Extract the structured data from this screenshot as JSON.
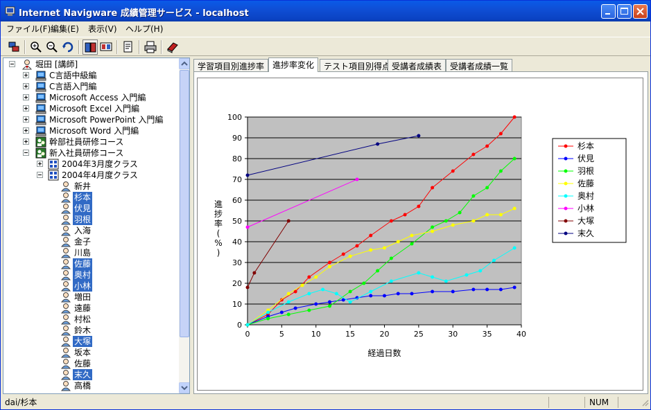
{
  "window": {
    "title": "Internet Navigware 成績管理サービス - localhost"
  },
  "menu": [
    {
      "label": "ファイル(F)"
    },
    {
      "label": "編集(E)"
    },
    {
      "label": "表示(V)"
    },
    {
      "label": "ヘルプ(H)"
    }
  ],
  "tree": {
    "root": "堀田 [講師]",
    "courses": [
      {
        "label": "C言語中級編"
      },
      {
        "label": "C言語入門編"
      },
      {
        "label": "Microsoft Access 入門編"
      },
      {
        "label": "Microsoft Excel 入門編"
      },
      {
        "label": "Microsoft PowerPoint 入門編"
      },
      {
        "label": "Microsoft Word 入門編"
      },
      {
        "label": "幹部社員研修コース"
      },
      {
        "label": "新入社員研修コース"
      }
    ],
    "classes": [
      {
        "label": "2004年3月度クラス"
      },
      {
        "label": "2004年4月度クラス"
      }
    ],
    "students": [
      {
        "label": "新井",
        "selected": false
      },
      {
        "label": "杉本",
        "selected": true
      },
      {
        "label": "伏見",
        "selected": true
      },
      {
        "label": "羽根",
        "selected": true
      },
      {
        "label": "入海",
        "selected": false
      },
      {
        "label": "金子",
        "selected": false
      },
      {
        "label": "川島",
        "selected": false
      },
      {
        "label": "佐藤",
        "selected": true
      },
      {
        "label": "奥村",
        "selected": true
      },
      {
        "label": "小林",
        "selected": true
      },
      {
        "label": "増田",
        "selected": false
      },
      {
        "label": "遠藤",
        "selected": false
      },
      {
        "label": "村松",
        "selected": false
      },
      {
        "label": "鈴木",
        "selected": false
      },
      {
        "label": "大塚",
        "selected": true
      },
      {
        "label": "坂本",
        "selected": false
      },
      {
        "label": "佐藤",
        "selected": false
      },
      {
        "label": "末久",
        "selected": true
      },
      {
        "label": "高橋",
        "selected": false
      }
    ]
  },
  "tabs": [
    {
      "label": "学習項目別進捗率",
      "active": false
    },
    {
      "label": "進捗率変化",
      "active": true
    },
    {
      "label": "テスト項目別得点",
      "active": false
    },
    {
      "label": "受講者成績表",
      "active": false
    },
    {
      "label": "受講者成績一覧",
      "active": false
    }
  ],
  "status": {
    "path": "dai/杉本",
    "num": "NUM"
  },
  "chart_data": {
    "type": "line",
    "title": "",
    "xlabel": "経過日数",
    "ylabel": "進捗率(%)",
    "xlim": [
      0,
      40
    ],
    "ylim": [
      0,
      100
    ],
    "xticks": [
      0,
      5,
      10,
      15,
      20,
      25,
      30,
      35,
      40
    ],
    "yticks": [
      0,
      10,
      20,
      30,
      40,
      50,
      60,
      70,
      80,
      90,
      100
    ],
    "grid": true,
    "legend": "right",
    "plot_bg": "#c0c0c0",
    "series": [
      {
        "name": "杉本",
        "color": "#ff0000",
        "x": [
          0,
          3,
          5,
          7,
          9,
          12,
          14,
          16,
          18,
          21,
          23,
          25,
          27,
          30,
          33,
          35,
          37,
          39
        ],
        "y": [
          0,
          5,
          12,
          16,
          23,
          30,
          34,
          38,
          43,
          50,
          53,
          57,
          66,
          74,
          82,
          86,
          92,
          100
        ]
      },
      {
        "name": "伏見",
        "color": "#0000ff",
        "x": [
          0,
          3,
          5,
          7,
          10,
          12,
          14,
          16,
          18,
          20,
          22,
          24,
          27,
          30,
          33,
          35,
          37,
          39
        ],
        "y": [
          0,
          4,
          6,
          8,
          10,
          11,
          12,
          13,
          14,
          14,
          15,
          15,
          16,
          16,
          17,
          17,
          17,
          18
        ]
      },
      {
        "name": "羽根",
        "color": "#00ff00",
        "x": [
          0,
          3,
          6,
          9,
          12,
          15,
          17,
          19,
          21,
          24,
          27,
          29,
          31,
          33,
          35,
          37,
          39
        ],
        "y": [
          0,
          3,
          5,
          7,
          9,
          16,
          20,
          26,
          32,
          39,
          47,
          50,
          54,
          62,
          66,
          74,
          80
        ]
      },
      {
        "name": "佐藤",
        "color": "#ffff00",
        "x": [
          0,
          3,
          6,
          8,
          10,
          12,
          15,
          18,
          20,
          22,
          24,
          27,
          30,
          33,
          35,
          37,
          39
        ],
        "y": [
          0,
          7,
          15,
          19,
          23,
          28,
          33,
          36,
          37,
          40,
          43,
          45,
          48,
          50,
          53,
          53,
          56
        ]
      },
      {
        "name": "奥村",
        "color": "#00ffff",
        "x": [
          0,
          3,
          6,
          9,
          11,
          13,
          15,
          18,
          21,
          25,
          27,
          29,
          32,
          34,
          36,
          39
        ],
        "y": [
          0,
          6,
          11,
          15,
          17,
          15,
          11,
          16,
          21,
          25,
          23,
          21,
          24,
          26,
          31,
          37
        ]
      },
      {
        "name": "小林",
        "color": "#ff00ff",
        "x": [
          0,
          16
        ],
        "y": [
          47,
          70
        ]
      },
      {
        "name": "大塚",
        "color": "#800000",
        "x": [
          0,
          1,
          6
        ],
        "y": [
          18,
          25,
          50
        ]
      },
      {
        "name": "末久",
        "color": "#000080",
        "x": [
          0,
          19,
          25
        ],
        "y": [
          72,
          87,
          91
        ]
      }
    ]
  }
}
